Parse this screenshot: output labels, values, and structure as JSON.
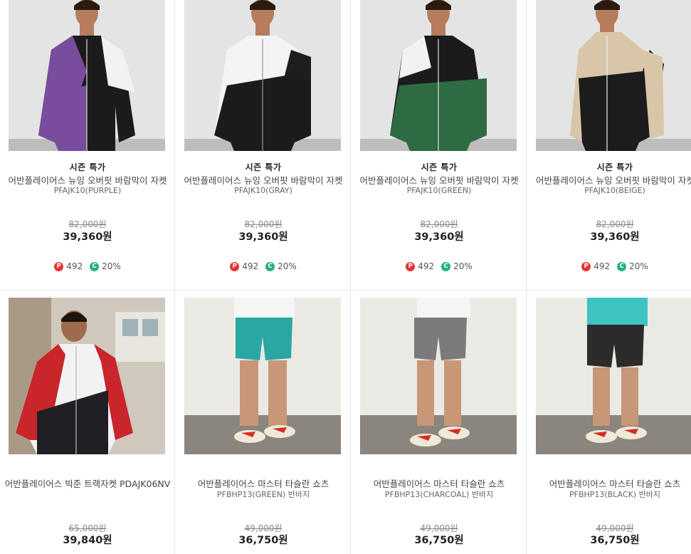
{
  "products": [
    {
      "badge": "시즌 특가",
      "name": "어반플레이어스 뉴잉 오버핏 바람막이 자켓",
      "code": "PFAJK10(PURPLE)",
      "original_price": "82,000원",
      "price": "39,360원",
      "points": "492",
      "coupon": "20%",
      "colors": {
        "bg": "#e4e4e4",
        "a": "#7a4c9e",
        "b": "#1b1b1b",
        "c": "#f2f2f2"
      }
    },
    {
      "badge": "시즌 특가",
      "name": "어반플레이어스 뉴잉 오버핏 바람막이 자켓",
      "code": "PFAJK10(GRAY)",
      "original_price": "82,000원",
      "price": "39,360원",
      "points": "492",
      "coupon": "20%",
      "colors": {
        "bg": "#e4e4e4",
        "a": "#1e1e1e",
        "b": "#1b1b1b",
        "c": "#f4f4f4"
      }
    },
    {
      "badge": "시즌 특가",
      "name": "어반플레이어스 뉴잉 오버핏 바람막이 자켓",
      "code": "PFAJK10(GREEN)",
      "original_price": "82,000원",
      "price": "39,360원",
      "points": "492",
      "coupon": "20%",
      "colors": {
        "bg": "#e4e4e4",
        "a": "#2f6b42",
        "b": "#1b1b1b",
        "c": "#f2f2f2"
      }
    },
    {
      "badge": "시즌 특가",
      "name": "어반플레이어스 뉴잉 오버핏 바람막이 자켓",
      "code": "PFAJK10(BEIGE)",
      "original_price": "82,000원",
      "price": "39,360원",
      "points": "492",
      "coupon": "20%",
      "colors": {
        "bg": "#e4e4e4",
        "a": "#1c1c1c",
        "b": "#d9c6a8",
        "c": "#d9c6a8"
      }
    },
    {
      "badge": "",
      "name": "어반플레이어스 빅준 트랙자켓 PDAJK06NV",
      "code": "",
      "original_price": "65,000원",
      "price": "39,840원",
      "colors": {
        "bg": "#cfc8bd",
        "a": "#c9252a",
        "b": "#1f1f24",
        "c": "#f2f2f2"
      }
    },
    {
      "badge": "",
      "name": "어반플레이어스 마스터 타슬란 쇼츠",
      "code": "PFBHP13(GREEN) 반바지",
      "original_price": "49,000원",
      "price": "36,750원",
      "colors": {
        "bg": "#ebe9e4",
        "a": "#2aa6a3",
        "b": "#f5f5f5",
        "c": "#c79778"
      }
    },
    {
      "badge": "",
      "name": "어반플레이어스 마스터 타슬란 쇼츠",
      "code": "PFBHP13(CHARCOAL) 반바지",
      "original_price": "49,000원",
      "price": "36,750원",
      "colors": {
        "bg": "#ebe9e4",
        "a": "#7b7b7b",
        "b": "#f5f5f5",
        "c": "#c79778"
      }
    },
    {
      "badge": "",
      "name": "어반플레이어스 마스터 타슬란 쇼츠",
      "code": "PFBHP13(BLACK) 반바지",
      "original_price": "49,000원",
      "price": "36,750원",
      "colors": {
        "bg": "#ebe9e4",
        "a": "#2b2b2b",
        "b": "#3ec3c0",
        "c": "#c79778"
      }
    }
  ]
}
